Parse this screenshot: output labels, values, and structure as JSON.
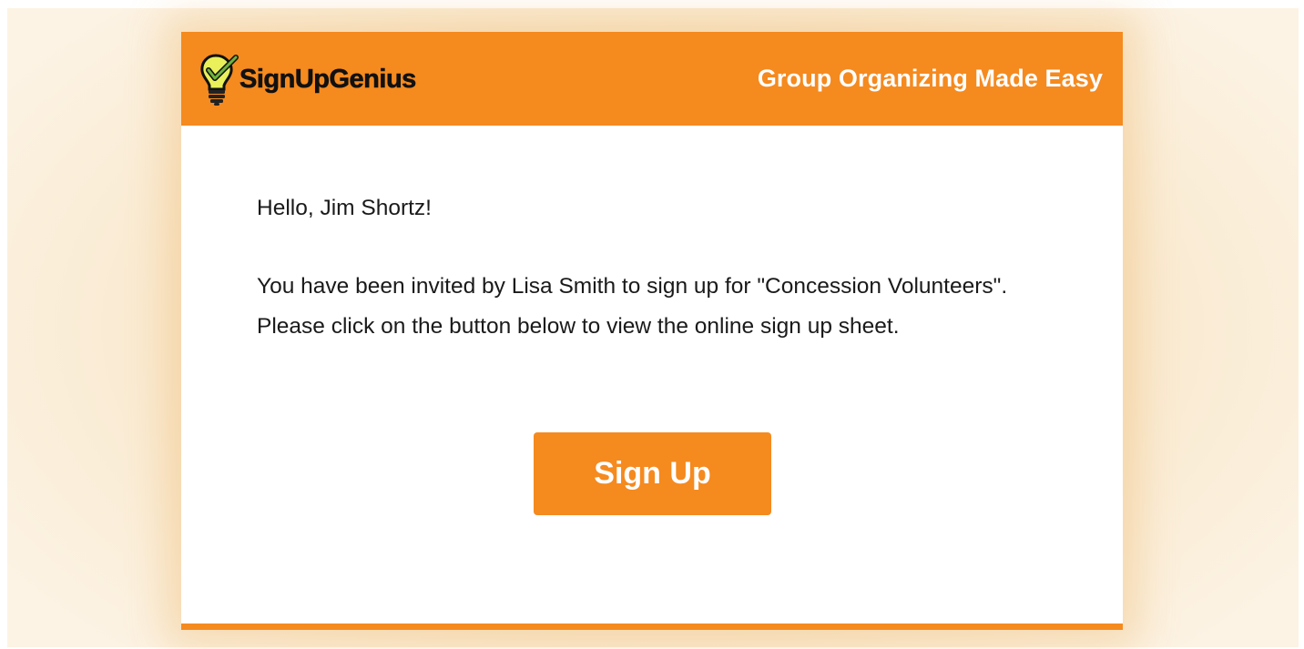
{
  "brand": {
    "name": "SignUpGenius",
    "tagline": "Group Organizing Made Easy",
    "logo_icon": "lightbulb-check-icon"
  },
  "email": {
    "greeting": "Hello, Jim Shortz!",
    "message": "You have been invited by Lisa Smith to sign up for \"Concession Volunteers\". Please click on the button below to view the online sign up sheet.",
    "button_label": "Sign Up"
  },
  "colors": {
    "brand_orange": "#f58a1f",
    "backdrop": "#f9e8cc",
    "text": "#1a1a1a"
  }
}
